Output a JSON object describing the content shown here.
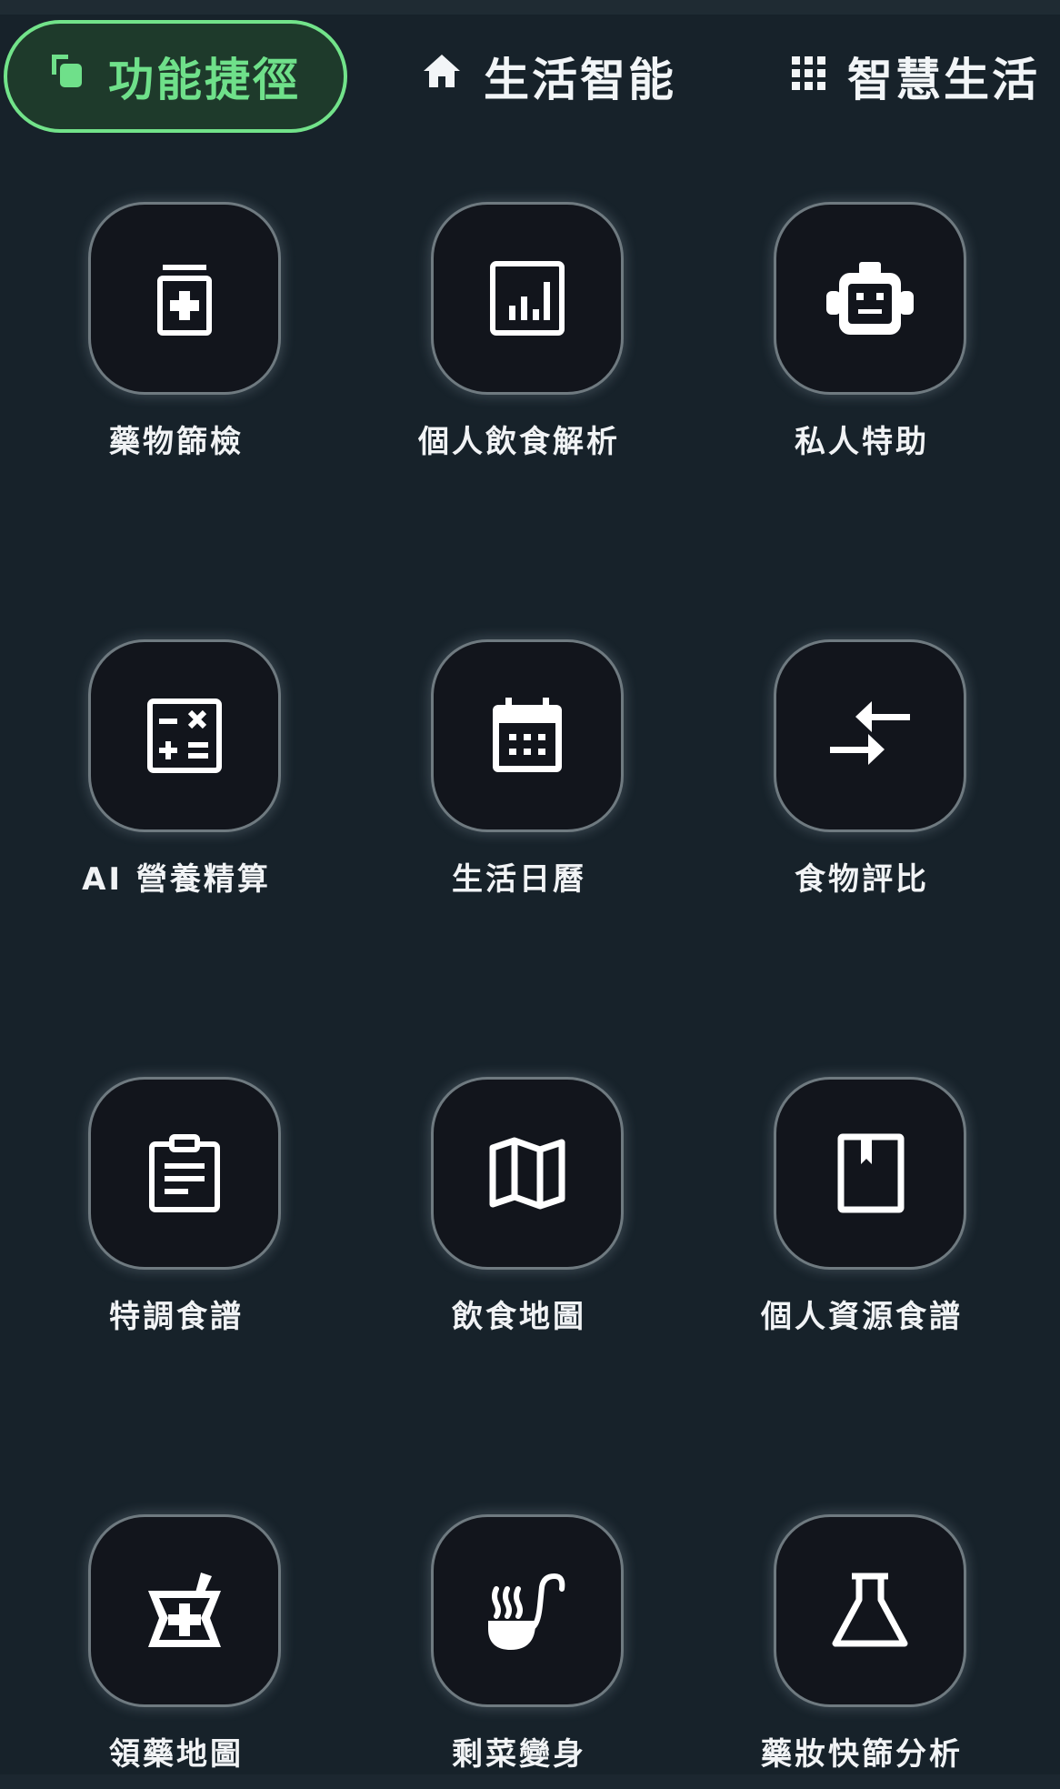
{
  "tabs": [
    {
      "label": "功能捷徑",
      "icon": "copy-icon",
      "active": true
    },
    {
      "label": "生活智能",
      "icon": "home-icon",
      "active": false
    },
    {
      "label": "智慧生活",
      "icon": "grid-icon",
      "active": false
    }
  ],
  "features": [
    {
      "label": "藥物篩檢",
      "icon": "medicine-bottle-icon"
    },
    {
      "label": "個人飲食解析",
      "icon": "bar-chart-icon"
    },
    {
      "label": "私人特助",
      "icon": "robot-icon"
    },
    {
      "label": "AI 營養精算",
      "icon": "calculator-icon"
    },
    {
      "label": "生活日曆",
      "icon": "calendar-icon"
    },
    {
      "label": "食物評比",
      "icon": "compare-arrows-icon"
    },
    {
      "label": "特調食譜",
      "icon": "clipboard-icon"
    },
    {
      "label": "飲食地圖",
      "icon": "map-icon"
    },
    {
      "label": "個人資源食譜",
      "icon": "book-icon"
    },
    {
      "label": "領藥地圖",
      "icon": "mortar-pestle-icon"
    },
    {
      "label": "剩菜變身",
      "icon": "soup-ladle-icon"
    },
    {
      "label": "藥妝快篩分析",
      "icon": "flask-icon"
    }
  ],
  "colors": {
    "background": "#17222a",
    "accent": "#6fe08a",
    "tile": "#12151c"
  }
}
